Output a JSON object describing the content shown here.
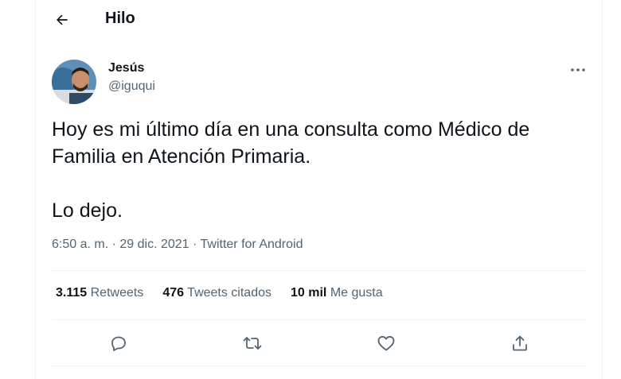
{
  "header": {
    "title": "Hilo",
    "back_icon": "arrow-left-icon"
  },
  "author": {
    "name": "Jesús",
    "handle": "@iguqui"
  },
  "tweet": {
    "text": "Hoy es mi último día en una consulta como Médico de Familia en Atención Primaria.\n\nLo dejo.",
    "time": "6:50 a. m.",
    "date": "29 dic. 2021",
    "source": "Twitter for Android"
  },
  "stats": [
    {
      "value": "3.115",
      "label": "Retweets"
    },
    {
      "value": "476",
      "label": "Tweets citados"
    },
    {
      "value": "10 mil",
      "label": "Me gusta"
    }
  ],
  "actions": [
    "reply-icon",
    "retweet-icon",
    "like-icon",
    "share-icon"
  ],
  "colors": {
    "text": "#0f1419",
    "secondary": "#536471",
    "divider": "#eff3f4"
  }
}
